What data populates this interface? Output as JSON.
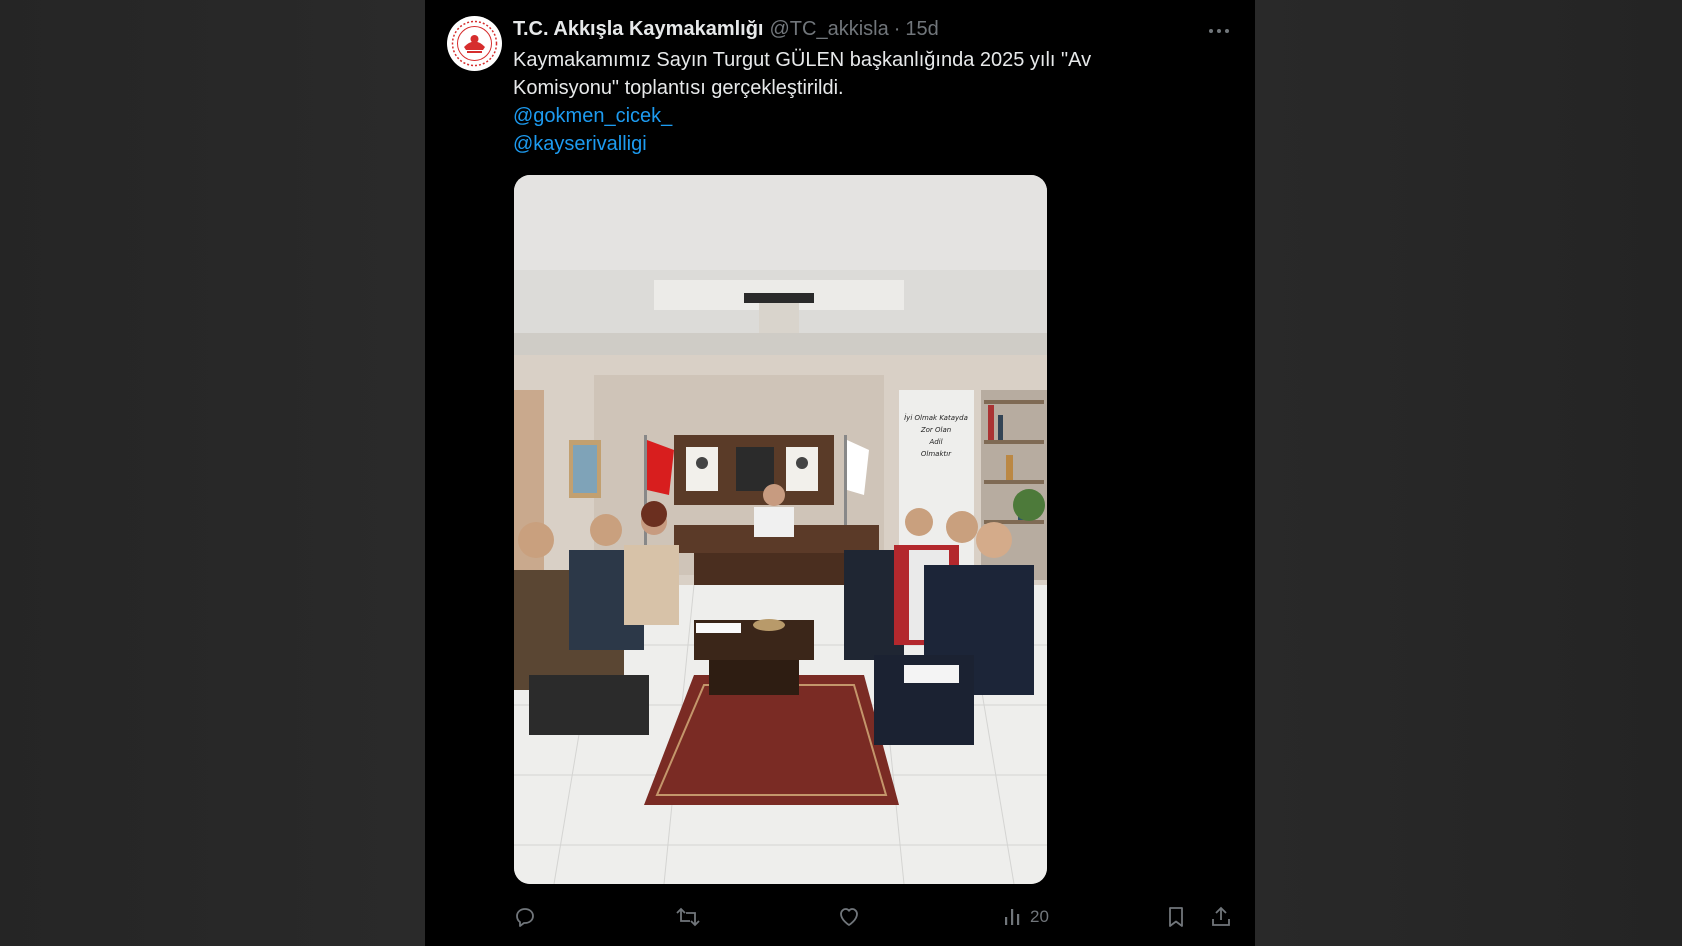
{
  "tweet": {
    "author_name": "T.C. Akkışla Kaymakamlığı",
    "handle": "@TC_akkisla",
    "separator": "·",
    "time": "15d",
    "text": "Kaymakamımız Sayın Turgut GÜLEN başkanlığında 2025 yılı \"Av Komisyonu\" toplantısı gerçekleştirildi.",
    "mentions": [
      "@gokmen_cicek_",
      "@kayserivalligi"
    ],
    "more_label": "···",
    "views_count": "20",
    "photo_wall_sign": [
      "İyi Olmak Katayda",
      "Zor Olan",
      "Adil",
      "Olmaktır"
    ]
  },
  "icons": {
    "reply": "reply-icon",
    "retweet": "retweet-icon",
    "like": "heart-icon",
    "views": "views-icon",
    "bookmark": "bookmark-icon",
    "share": "share-icon",
    "more": "more-icon"
  },
  "colors": {
    "background": "#000000",
    "text_primary": "#e7e9ea",
    "text_secondary": "#71767b",
    "link": "#1d9bf0",
    "avatar_emblem": "#d62d2d"
  }
}
